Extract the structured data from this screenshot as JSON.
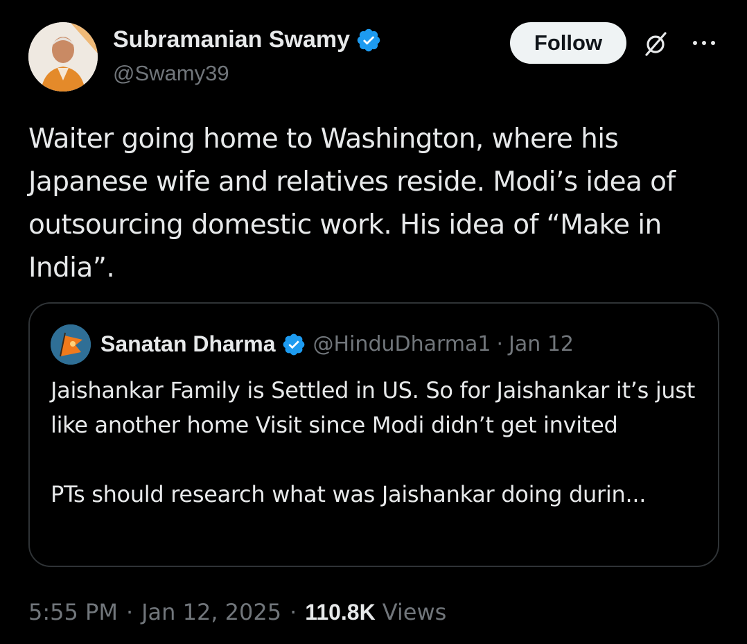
{
  "author": {
    "name": "Subramanian Swamy",
    "handle": "@Swamy39",
    "verified": true
  },
  "actions": {
    "follow_label": "Follow",
    "grok_icon": "grok-icon",
    "more_icon": "more-icon"
  },
  "tweet": {
    "text": "Waiter going home to Washington, where his Japanese wife and relatives reside. Modi’s idea of outsourcing domestic work. His idea of “Make in India”."
  },
  "quote": {
    "name": "Sanatan Dharma",
    "handle": "@HinduDharma1",
    "date": "Jan 12",
    "dot": "·",
    "paragraphs": [
      "Jaishankar Family is Settled in US. So for Jaishankar it’s just like another home Visit since Modi didn’t get invited",
      "PTs should research what was Jaishankar doing durin..."
    ]
  },
  "meta": {
    "time": "5:55 PM",
    "date": "Jan 12, 2025",
    "separator": "·",
    "views_count": "110.8K",
    "views_label": "Views"
  },
  "colors": {
    "background": "#000000",
    "text": "#e7e9ea",
    "muted": "#71767b",
    "verified": "#1d9bf0",
    "border": "#2f3336"
  }
}
